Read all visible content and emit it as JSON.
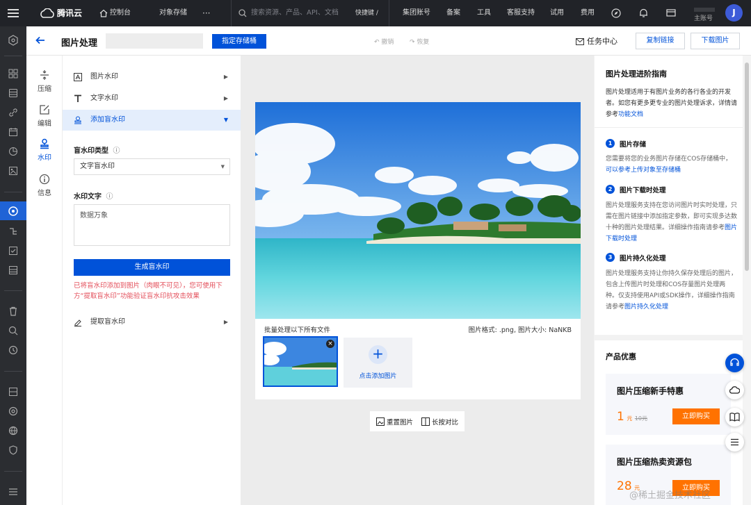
{
  "topbar": {
    "brand": "腾讯云",
    "console": "控制台",
    "product": "对象存储",
    "more": "···",
    "search_placeholder": "搜索资源、产品、API、文档",
    "shortcut": "快捷键 /",
    "links": [
      "集团账号",
      "备案",
      "工具",
      "客服支持",
      "试用",
      "费用"
    ],
    "account_label": "主账号",
    "avatar_letter": "J"
  },
  "header": {
    "title": "图片处理",
    "bucket_button": "指定存储桶",
    "undo": "撤销",
    "redo": "恢复",
    "task_center": "任务中心",
    "copy_link": "复制链接",
    "download": "下载图片"
  },
  "tools": [
    {
      "label": "压缩",
      "icon": "compress-icon"
    },
    {
      "label": "编辑",
      "icon": "edit-icon"
    },
    {
      "label": "水印",
      "icon": "watermark-icon"
    },
    {
      "label": "信息",
      "icon": "info-icon"
    }
  ],
  "panel": {
    "image_watermark": "图片水印",
    "text_watermark": "文字水印",
    "add_blind_watermark": "添加盲水印",
    "blind_type_label": "盲水印类型",
    "blind_type_value": "文字盲水印",
    "watermark_text_label": "水印文字",
    "watermark_text_value": "数据万象",
    "generate_button": "生成盲水印",
    "notice": "已将盲水印添加到图片（肉眼不可见），您可使用下方“提取盲水印”功能验证盲水印抗攻击效果",
    "extract_blind_watermark": "提取盲水印"
  },
  "canvas": {
    "batch_label": "批量处理以下所有文件",
    "format_info": "图片格式: .png, 图片大小: NaNKB",
    "add_image": "点击添加图片",
    "reset_image": "重置图片",
    "compare": "长按对比"
  },
  "guide": {
    "title": "图片处理进阶指南",
    "intro": "图片处理适用于有图片业务的各行各业的开发者。如您有更多更专业的图片处理诉求，详情请参考",
    "intro_link": "功能文档",
    "steps": [
      {
        "num": "1",
        "title": "图片存储",
        "text": "您需要将您的业务图片存储在COS存储桶中，",
        "link": "可以参考上传对象至存储桶"
      },
      {
        "num": "2",
        "title": "图片下载时处理",
        "text": "图片处理服务支持在您访问图片时实时处理，只需在图片链接中添加指定参数，即可实现多达数十种的图片处理结果。详细操作指南请参考",
        "link": "图片下载时处理"
      },
      {
        "num": "3",
        "title": "图片持久化处理",
        "text": "图片处理服务支持让你持久保存处理后的图片，包含上传图片时处理和COS存量图片处理两种。仅支持使用API或SDK操作，详细操作指南请参考",
        "link": "图片持久化处理"
      }
    ]
  },
  "offers": {
    "title": "产品优惠",
    "items": [
      {
        "name": "图片压缩新手特惠",
        "price": "1",
        "unit": "元",
        "old_price": "10元",
        "button": "立即购买"
      },
      {
        "name": "图片压缩热卖资源包",
        "price": "28",
        "unit": "元",
        "button": "立即购买"
      }
    ]
  },
  "watermark_overlay": "@稀土掘金技术社区",
  "colors": {
    "accent": "#0052d9",
    "topbar": "#212328",
    "buy": "#ff7200",
    "notice": "#e34d59"
  }
}
